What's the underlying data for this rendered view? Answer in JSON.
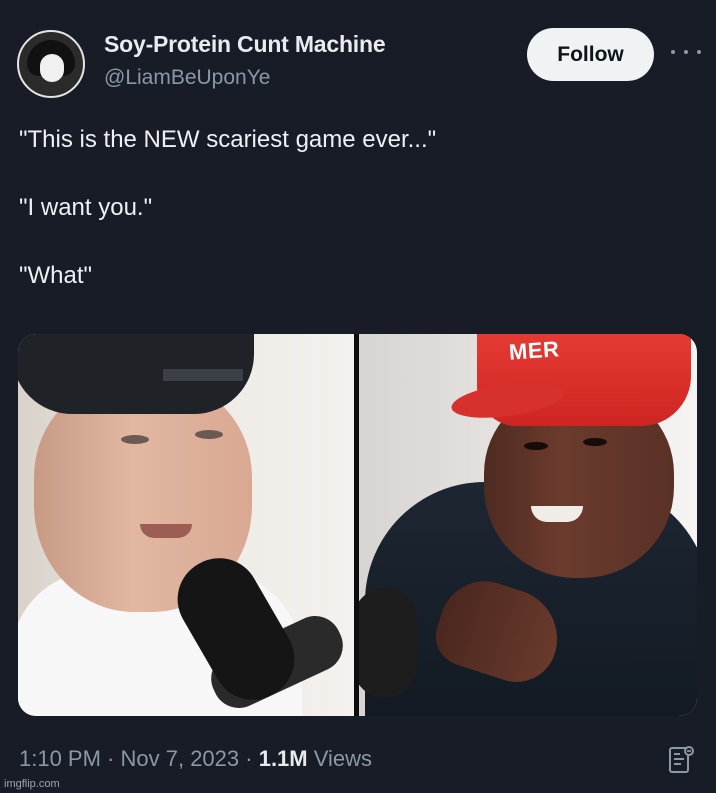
{
  "author": {
    "display_name": "Soy-Protein Cunt Machine",
    "handle": "@LiamBeUponYe"
  },
  "actions": {
    "follow_label": "Follow",
    "more_icon": "more-horizontal-icon",
    "analytics_icon": "analytics-icon"
  },
  "tweet": {
    "lines": [
      "\"This is the NEW scariest game ever...\"",
      "\"I want you.\"",
      "\"What\""
    ]
  },
  "media": {
    "cap_text": "MER"
  },
  "meta": {
    "time": "1:10 PM",
    "separator": " · ",
    "date": "Nov 7, 2023",
    "views_count": "1.1M",
    "views_label": "Views"
  },
  "watermark": "imgflip.com",
  "colors": {
    "background": "#171c27",
    "follow_button_bg": "#eff3f4",
    "follow_button_text": "#0f1419",
    "primary_text": "#e7e9ea",
    "secondary_text": "#8b98a5"
  }
}
